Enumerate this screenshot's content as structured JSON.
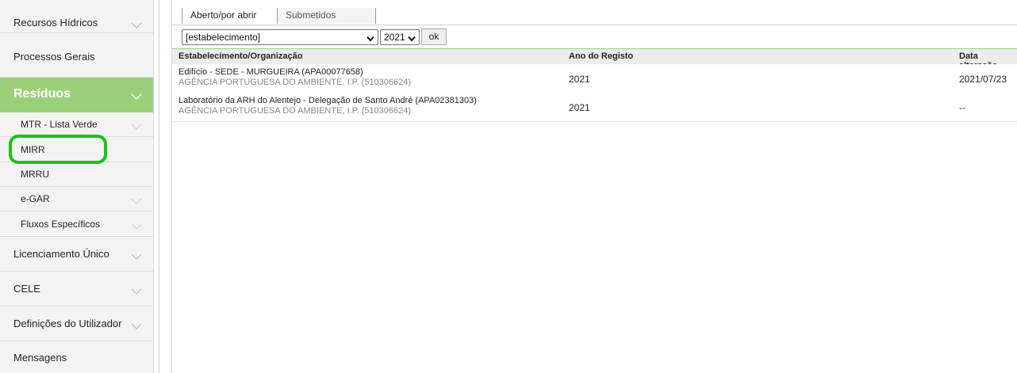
{
  "sidebar": {
    "items": [
      {
        "label": "Recursos Hídricos",
        "chevron": true
      },
      {
        "label": "Processos Gerais",
        "chevron": false
      },
      {
        "label": "Resíduos",
        "chevron": true,
        "active": true
      },
      {
        "label": "MTR - Lista Verde",
        "chevron": true,
        "sub": true
      },
      {
        "label": "MIRR",
        "chevron": false,
        "sub": true
      },
      {
        "label": "MRRU",
        "chevron": false,
        "sub": true
      },
      {
        "label": "e-GAR",
        "chevron": true,
        "sub": true
      },
      {
        "label": "Fluxos Específicos",
        "chevron": true,
        "sub": true
      },
      {
        "label": "Licenciamento Único",
        "chevron": true
      },
      {
        "label": "CELE",
        "chevron": true
      },
      {
        "label": "Definições do Utilizador",
        "chevron": true
      },
      {
        "label": "Mensagens",
        "chevron": false
      }
    ]
  },
  "tabs": [
    {
      "label": "Aberto/por abrir",
      "active": true
    },
    {
      "label": "Submetidos",
      "active": false
    }
  ],
  "filters": {
    "establishment": "[estabelecimento]",
    "year": "2021",
    "ok_label": "ok"
  },
  "table": {
    "headers": [
      "Estabelecimento/Organização",
      "Ano do Registo",
      "Data alteração"
    ],
    "rows": [
      {
        "name": "Edifício - SEDE - MURGUEIRA (APA00077658)",
        "org": "AGÊNCIA PORTUGUESA DO AMBIENTE, I.P. (510306624)",
        "year": "2021",
        "date": "2021/07/23"
      },
      {
        "name": "Laboratório da ARH do Alentejo - Delegação de Santo André (APA02381303)",
        "org": "AGÊNCIA PORTUGUESA DO AMBIENTE, I.P. (510306624)",
        "year": "2021",
        "date": "--"
      }
    ]
  },
  "colors": {
    "accent": "#9ccf7a",
    "highlight": "#19c319"
  }
}
